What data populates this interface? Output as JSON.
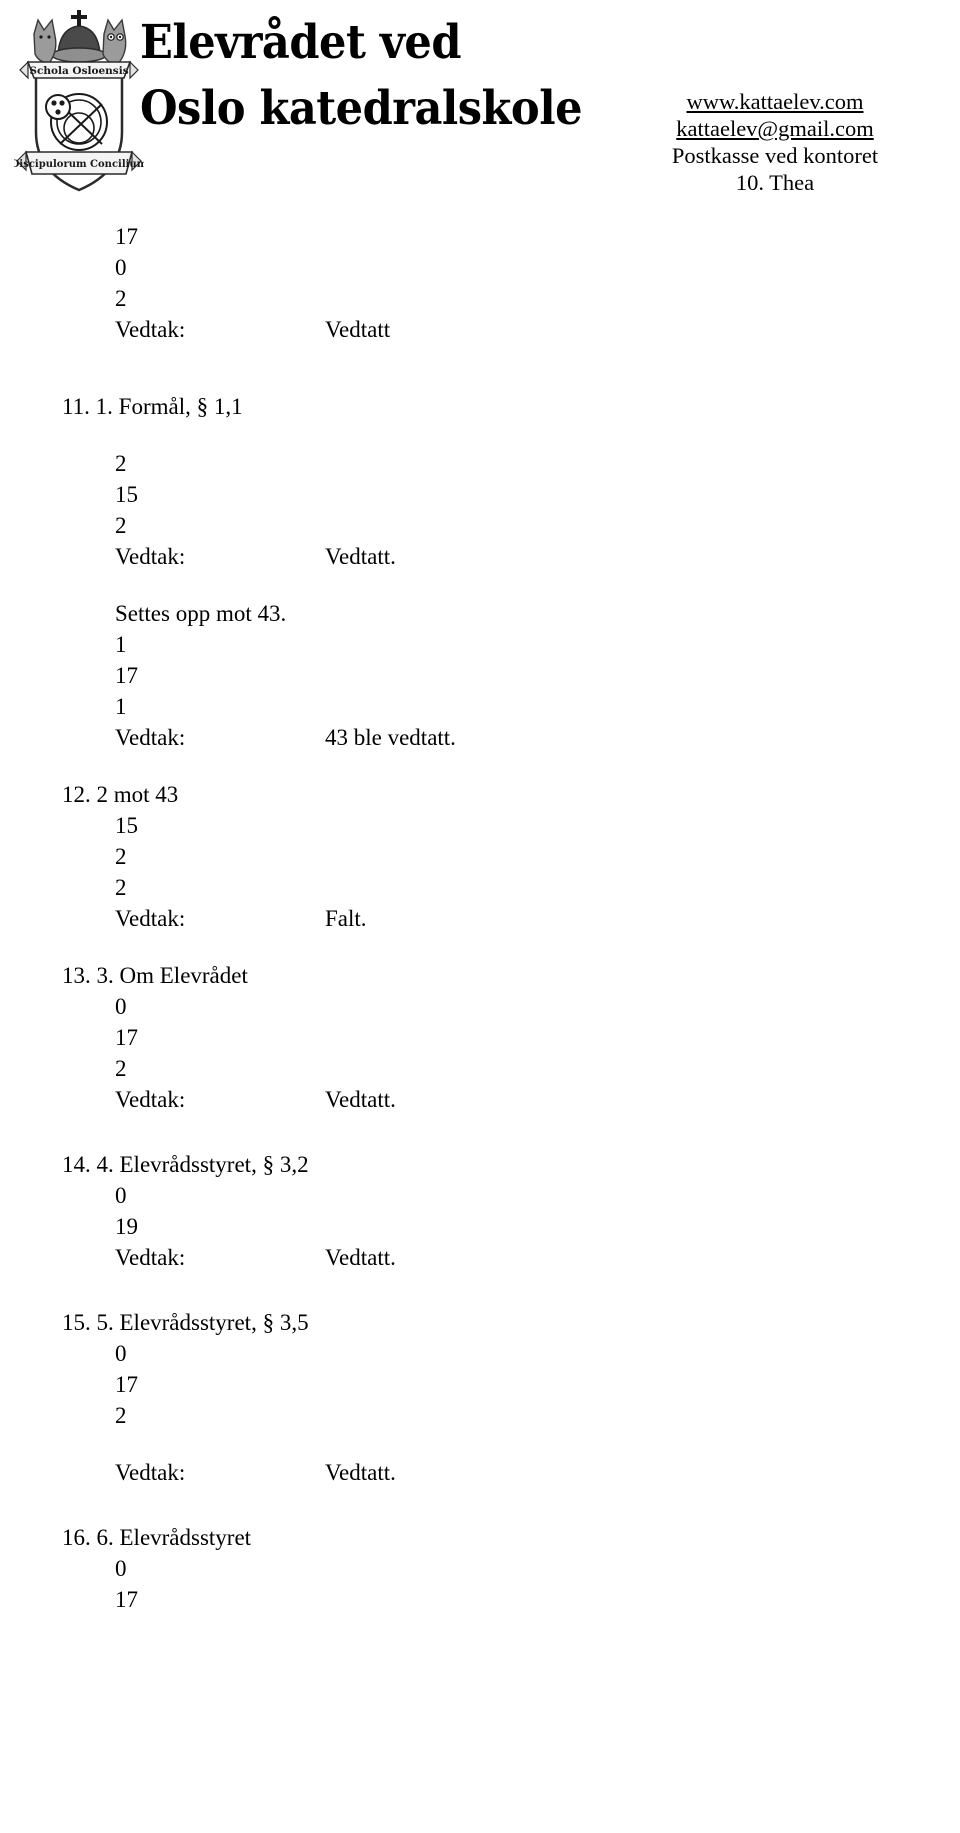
{
  "header": {
    "crest_name": "oslo-katedralskole-crest",
    "crest_top_banner": "Schola Osloensis",
    "crest_bottom_banner": "Discipulorum Concilium",
    "masthead_line1": "Elevrådet ved",
    "masthead_line2": "Oslo katedralskole",
    "contact": {
      "website": "www.kattaelev.com",
      "email": "kattaelev@gmail.com",
      "mailbox": "Postkasse ved kontoret",
      "person": "10.  Thea"
    }
  },
  "body": {
    "top_block": {
      "values": [
        "17",
        "0",
        "2"
      ],
      "vedtak_label": "Vedtak:",
      "vedtak_value": "Vedtatt"
    },
    "items": [
      {
        "number": "11.",
        "title": "1. Formål, § 1,1",
        "values": [
          "2",
          "15",
          "2"
        ],
        "vedtak_label": "Vedtak:",
        "vedtak_value": "Vedtatt.",
        "note": "Settes opp mot 43.",
        "note_values": [
          "1",
          "17",
          "1"
        ],
        "note_vedtak_label": "Vedtak:",
        "note_vedtak_value": "43 ble vedtatt."
      },
      {
        "number": "12.",
        "title": "2 mot 43",
        "values": [
          "15",
          "2",
          "2"
        ],
        "vedtak_label": "Vedtak:",
        "vedtak_value": "Falt."
      },
      {
        "number": "13.",
        "title": "3. Om Elevrådet",
        "values": [
          "0",
          "17",
          "2"
        ],
        "vedtak_label": "Vedtak:",
        "vedtak_value": "Vedtatt."
      },
      {
        "number": "14.",
        "title": "4. Elevrådsstyret, § 3,2",
        "values": [
          "0",
          "19"
        ],
        "vedtak_label": "Vedtak:",
        "vedtak_value": "Vedtatt."
      },
      {
        "number": "15.",
        "title": "5. Elevrådsstyret, § 3,5",
        "values": [
          "0",
          "17",
          "2"
        ],
        "vedtak_label": "Vedtak:",
        "vedtak_value": "Vedtatt."
      },
      {
        "number": "16.",
        "title": "6. Elevrådsstyret",
        "values": [
          "0",
          "17"
        ]
      }
    ]
  }
}
